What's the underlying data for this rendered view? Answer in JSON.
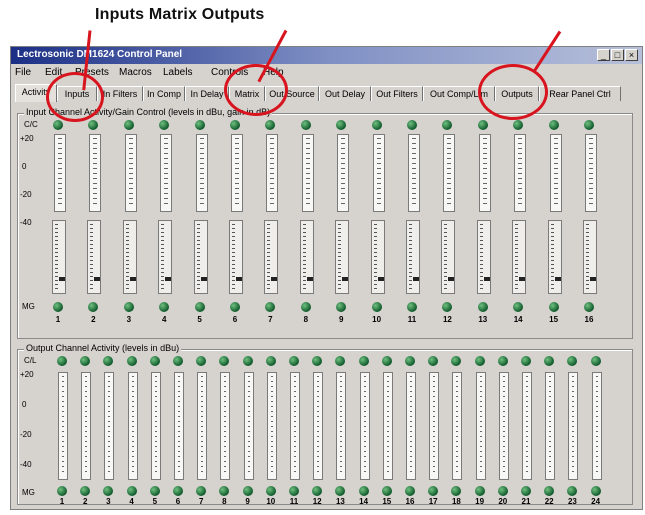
{
  "caption": "Inputs Matrix Outputs",
  "window": {
    "title": "Lectrosonic DM1624 Control Panel",
    "buttons": {
      "minimize": "_",
      "maximize": "□",
      "close": "×"
    }
  },
  "menu": [
    "File",
    "Edit",
    "Presets",
    "Macros",
    "Labels",
    "Controls",
    "Help"
  ],
  "tabs": [
    "Activity",
    "Inputs",
    "In Filters",
    "In Comp",
    "In Delay",
    "Matrix",
    "Out Source",
    "Out Delay",
    "Out Filters",
    "Out Comp/Lim",
    "Outputs",
    "Rear Panel Ctrl"
  ],
  "input_panel": {
    "title": "Input Channel Activity/Gain Control (levels in dBu, gain in dB)",
    "top_row_label": "C/C",
    "scale": [
      "+20",
      "0",
      "-20",
      "-40"
    ],
    "bottom_row_label": "MG",
    "channels": [
      "1",
      "2",
      "3",
      "4",
      "5",
      "6",
      "7",
      "8",
      "9",
      "10",
      "11",
      "12",
      "13",
      "14",
      "15",
      "16"
    ]
  },
  "output_panel": {
    "title": "Output Channel Activity (levels in dBu)",
    "top_row_label": "C/L",
    "scale": [
      "+20",
      "0",
      "-20",
      "-40"
    ],
    "bottom_row_label": "MG",
    "channels": [
      "1",
      "2",
      "3",
      "4",
      "5",
      "6",
      "7",
      "8",
      "9",
      "10",
      "11",
      "12",
      "13",
      "14",
      "15",
      "16",
      "17",
      "18",
      "19",
      "20",
      "21",
      "22",
      "23",
      "24"
    ]
  },
  "colors": {
    "annotation_red": "#d8141e",
    "led_green": "#0f5b2c",
    "title_blue": "#1b2f86"
  }
}
